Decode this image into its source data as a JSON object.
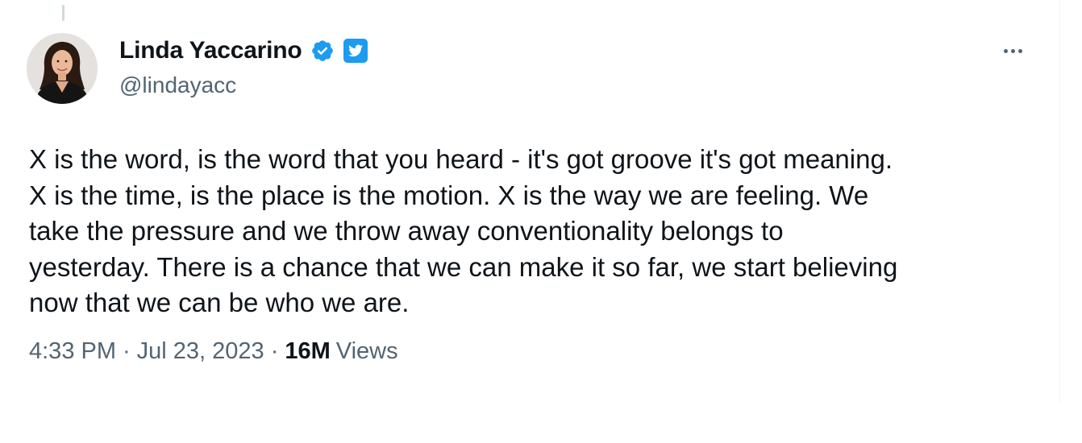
{
  "user": {
    "display_name": "Linda Yaccarino",
    "handle": "@lindayacc",
    "avatar_icon": "profile-photo",
    "verified_icon": "verified-badge-icon",
    "affiliate_icon": "twitter-bird-icon",
    "verified_color": "#1d9bf0"
  },
  "tweet": {
    "lines": [
      "X is the word, is the word that you heard - it's got groove it's got meaning.",
      "X is the time, is the place is the motion. X is the way we are feeling. We",
      "take the pressure and we throw away conventionality belongs to",
      "yesterday. There is a chance that we can make it so far, we start believing",
      "now that we can be who we are."
    ]
  },
  "meta": {
    "time": "4:33 PM",
    "separator": "·",
    "date": "Jul 23, 2023",
    "views_count": "16M",
    "views_label": "Views"
  },
  "colors": {
    "text_primary": "#0f1419",
    "text_secondary": "#536471",
    "brand_blue": "#1d9bf0"
  }
}
